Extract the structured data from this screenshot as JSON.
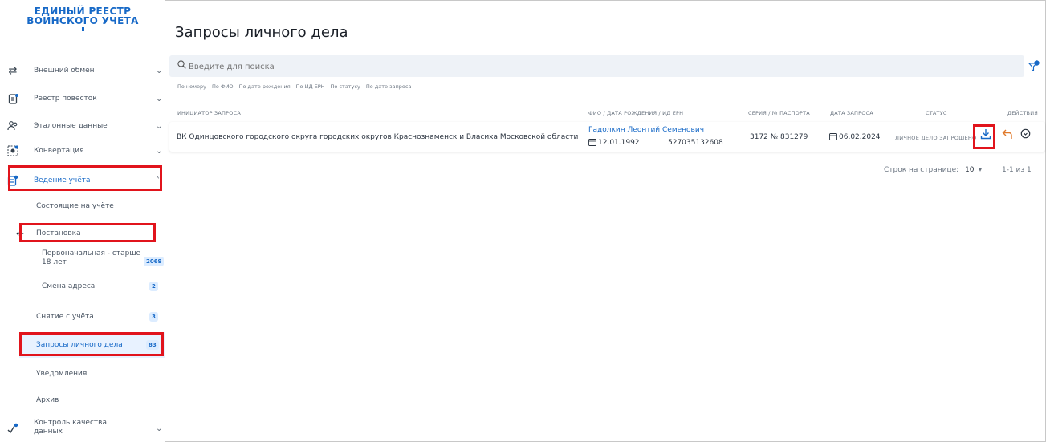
{
  "logo": {
    "line1": "ЕДИНЫЙ РЕЕСТР",
    "line2": "ВОИНСКОГО УЧЕТА"
  },
  "sidebar": {
    "items": [
      {
        "label": "Внешний обмен",
        "icon": "exchange-icon"
      },
      {
        "label": "Реестр повесток",
        "icon": "summons-icon"
      },
      {
        "label": "Эталонные данные",
        "icon": "people-icon"
      },
      {
        "label": "Конвертация",
        "icon": "convert-icon"
      },
      {
        "label": "Ведение учёта",
        "icon": "registry-icon"
      }
    ],
    "subitems": [
      {
        "label": "Состоящие на учёте"
      },
      {
        "label": "Постановка"
      },
      {
        "label": "Первоначальная - старше",
        "label2": "18 лет",
        "badge": "2069"
      },
      {
        "label": "Смена адреса",
        "badge": "2"
      },
      {
        "label": "Снятие с учёта",
        "badge": "3"
      },
      {
        "label": "Запросы личного дела",
        "badge": "83"
      },
      {
        "label": "Уведомления"
      },
      {
        "label": "Архив"
      }
    ],
    "quality": {
      "label1": "Контроль качества",
      "label2": "данных"
    }
  },
  "main": {
    "title": "Запросы личного дела",
    "search_placeholder": "Введите для поиска",
    "filters": [
      "По номеру",
      "По ФИО",
      "По дате рождения",
      "По ИД ЕРН",
      "По статусу",
      "По дате запроса"
    ],
    "columns": [
      "ИНИЦИАТОР ЗАПРОСА",
      "ФИО / ДАТА РОЖДЕНИЯ / ИД ЕРН",
      "СЕРИЯ / № ПАСПОРТА",
      "ДАТА ЗАПРОСА",
      "СТАТУС",
      "ДЕЙСТВИЯ"
    ],
    "rows": [
      {
        "initiator": "ВК Одинцовского городского округа городских округов Краснознаменск и Власиха Московской области",
        "fio": "Гадолкин Леонтий Семенович",
        "birth": "12.01.1992",
        "ern": "527035132608",
        "passport": "3172 № 831279",
        "request_date": "06.02.2024",
        "status": "ЛИЧНОЕ ДЕЛО ЗАПРОШЕНО"
      }
    ],
    "pager": {
      "label": "Строк на странице:",
      "size": "10",
      "range": "1-1 из 1"
    }
  },
  "colors": {
    "accent": "#1769c7",
    "highlight": "#e1141c",
    "back_arrow": "#e07a2c"
  }
}
